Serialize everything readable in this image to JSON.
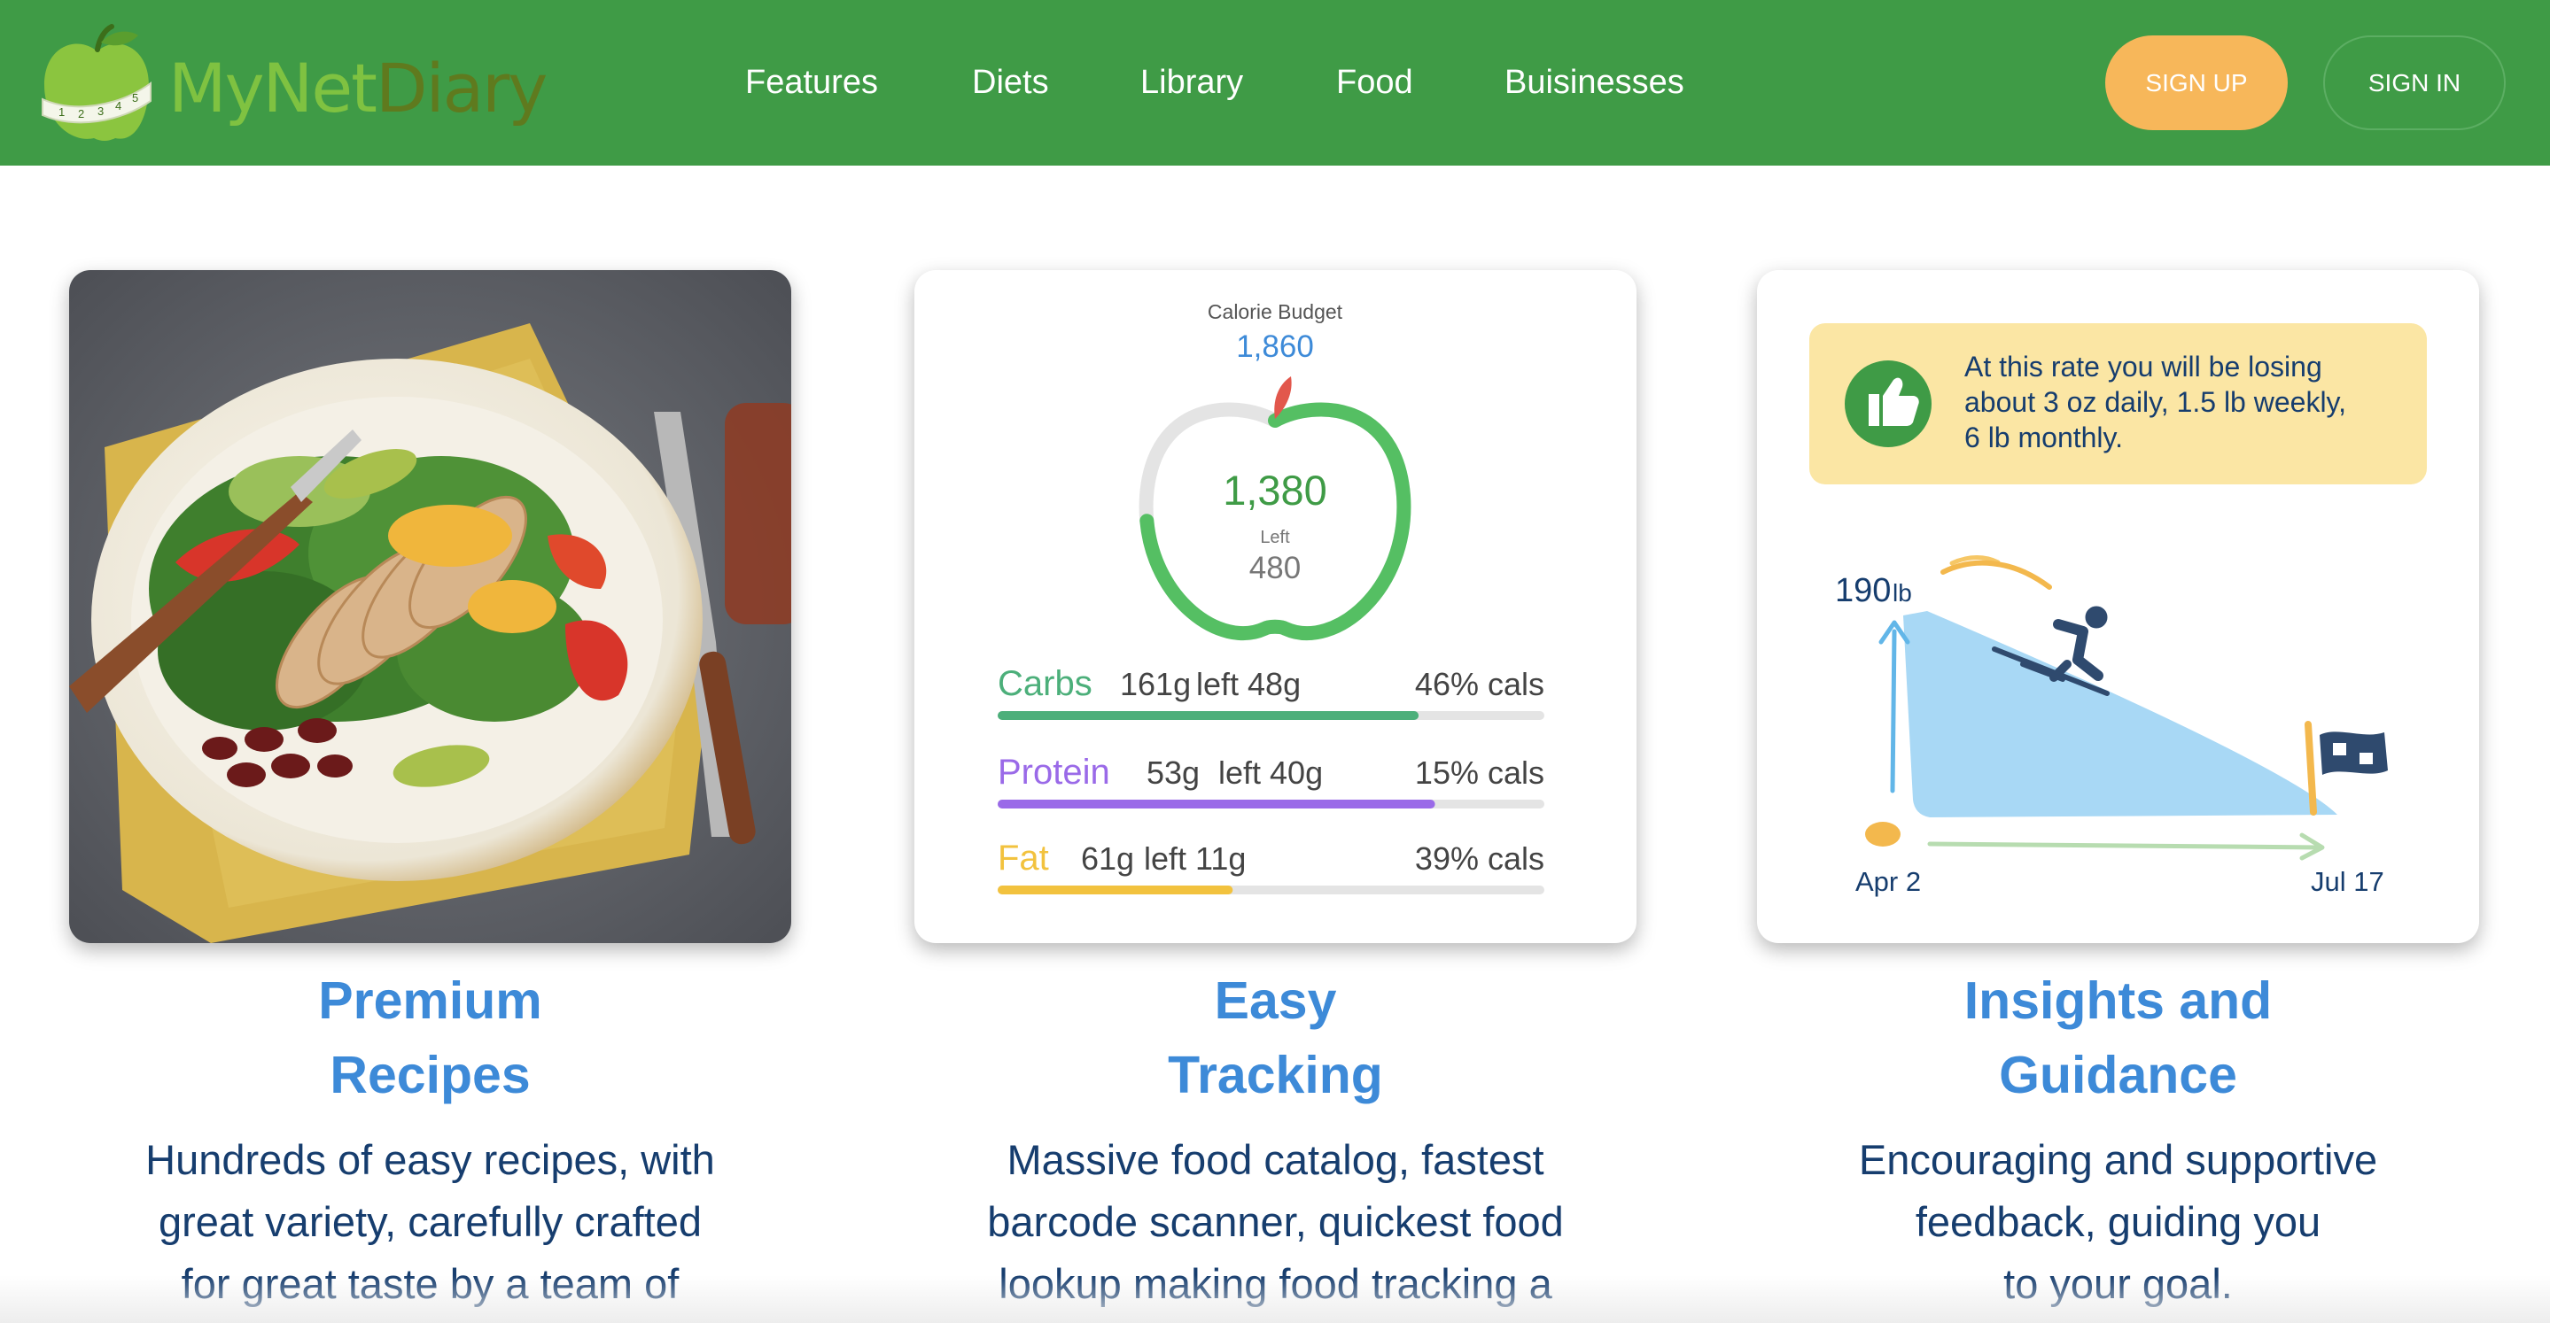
{
  "brand": {
    "name_part1": "MyNet",
    "name_part2": "Diary",
    "tape_numbers": [
      "1",
      "2",
      "3",
      "4",
      "5"
    ]
  },
  "nav": {
    "items": [
      {
        "label": "Features"
      },
      {
        "label": "Diets"
      },
      {
        "label": "Library"
      },
      {
        "label": "Food"
      },
      {
        "label": "Buisinesses"
      }
    ],
    "sign_up": "SIGN UP",
    "sign_in": "SIGN IN"
  },
  "colors": {
    "header_bg": "#3f9b46",
    "signup_bg": "#f7b75a",
    "title_blue": "#3d8ad8",
    "body_navy": "#163d6e",
    "carbs": "#4caf7a",
    "protein": "#9a6ae8",
    "fat": "#f2c23e"
  },
  "features": [
    {
      "title_line1": "Premium",
      "title_line2": "Recipes",
      "desc_line1": "Hundreds of easy recipes, with",
      "desc_line2": "great variety, carefully crafted",
      "desc_line3": "for great taste by a team of",
      "image": "salad-plate-photo"
    },
    {
      "title_line1": "Easy",
      "title_line2": "Tracking",
      "desc_line1": "Massive food catalog, fastest",
      "desc_line2": "barcode scanner, quickest food",
      "desc_line3": "lookup making food tracking a"
    },
    {
      "title_line1": "Insights and",
      "title_line2": "Guidance",
      "desc_line1": "Encouraging and supportive",
      "desc_line2": "feedback, guiding you",
      "desc_line3": "to your goal."
    }
  ],
  "tracker": {
    "budget_label": "Calorie Budget",
    "budget_value": "1,860",
    "consumed": "1,380",
    "left_label": "Left",
    "left_value": "480",
    "consumed_fraction": 0.742,
    "macros": [
      {
        "name": "Carbs",
        "grams": "161g",
        "left": "left 48g",
        "pct": "46% cals",
        "progress": 0.77
      },
      {
        "name": "Protein",
        "grams": "53g",
        "left": "left 40g",
        "pct": "15% cals",
        "progress": 0.8
      },
      {
        "name": "Fat",
        "grams": "61g",
        "left": "left 11g",
        "pct": "39% cals",
        "progress": 0.43
      }
    ]
  },
  "insight": {
    "message_line1": "At this rate you will be losing",
    "message_line2": "about 3 oz daily, 1.5 lb weekly,",
    "message_line3": "6 lb monthly.",
    "start_weight_value": "190",
    "start_weight_unit": "lb",
    "start_date": "Apr 2",
    "end_date": "Jul 17"
  }
}
